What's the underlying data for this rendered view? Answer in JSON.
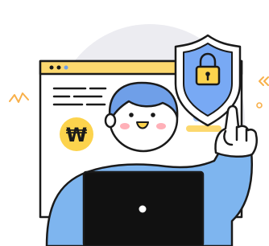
{
  "illustration": {
    "currency_badge": {
      "symbol": "₩",
      "icon": "won-coin-icon"
    },
    "shield": {
      "icon": "shield-lock-icon"
    },
    "colors": {
      "backdrop_circle": "#ececf1",
      "browser_bar": "#fcd86e",
      "currency_coin": "#fcd34d",
      "shield_fill": "#78a9f4",
      "shirt": "#7eb5ef",
      "hair": "#6f9fe8",
      "skin": "#ffffff",
      "blush": "#ffb0b8",
      "laptop": "#111111",
      "outline": "#1a1a1a",
      "decor_orange": "#f8b04a",
      "decor_blue": "#a4c4f4"
    }
  }
}
